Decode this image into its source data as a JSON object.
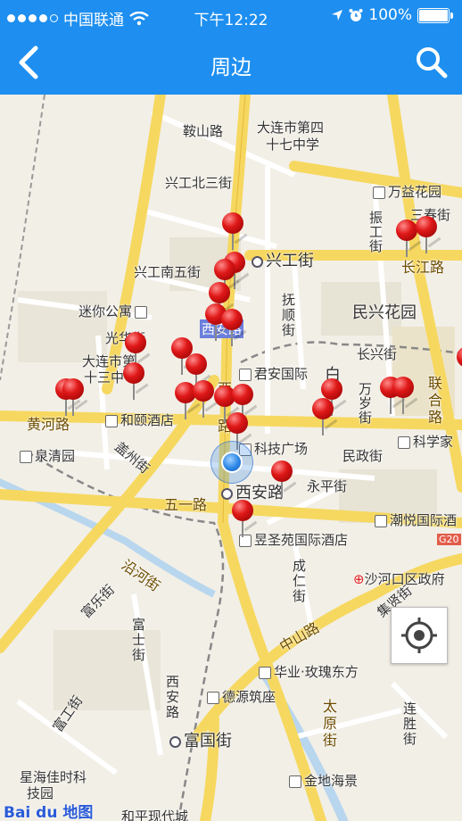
{
  "status_bar": {
    "carrier": "中国联通",
    "time": "下午12:22",
    "battery": "100%"
  },
  "nav": {
    "title": "周边"
  },
  "map": {
    "labels": {
      "anshan_lu": "鞍山路",
      "school_1": "大连市第四",
      "school_2": "十七中学",
      "xinggong_bei3": "兴工北三街",
      "wanyi_garden": "万益花园",
      "zhengong_jie": "振工街",
      "sanchun_jie": "三春街",
      "xinggong_jie": "兴工街",
      "changjiang_lu": "长江路",
      "xinggong_nan5": "兴工南五街",
      "fushun_jie": "抚顺街",
      "minxing_garden": "民兴花园",
      "mini_apartment": "迷你公寓",
      "xi_anlu_highlight": "西安路",
      "guanghua_jie": "光华街",
      "changxing_jie": "长兴街",
      "school13_1": "大连市第",
      "school13_2": "十三中",
      "junan_intl": "君安国际",
      "bai": "白",
      "wansui_jie": "万岁街",
      "lianhe_lu": "联合路",
      "xi_vertical": "西",
      "huanghe_lu": "黄河路",
      "heyi_hotel": "和颐酒店",
      "lu_vertical": "路",
      "keji_guangchang": "科技广场",
      "kexuejia": "科学家",
      "gaizhou_jie": "盖州街",
      "quanqing_yuan": "泉清园",
      "minzheng_jie": "民政街",
      "xian_lu": "西安路",
      "yongping_jie": "永平街",
      "wuyi_lu": "五一路",
      "chaoyue_intl": "潮悦国际酒",
      "g20": "G20",
      "yishengyuan_hotel": "昱圣苑国际酒店",
      "chengren_jie": "成仁街",
      "shahekou_gov": "沙河口区政府",
      "yanhe_jie": "沿河街",
      "zhongshan_lu": "中山路",
      "jixian_jie": "集贤街",
      "fule_jie": "富乐街",
      "fushi_jie": "富士街",
      "huaye_meigui": "华业·玫瑰东方",
      "deyuan_zhuzuo": "德源筑座",
      "xian_lu_vertical": "西安路",
      "fugong_jie": "富工街",
      "taiyuan_jie": "太原街",
      "liansheng_jie": "连胜街",
      "fuguo_jie": "富国街",
      "xinghai_jiake": "星海佳时科",
      "jiyuan": "技园",
      "jindi_haijing": "金地海景",
      "heping_dai": "和平现代城"
    },
    "logo": "Bai du 地图",
    "pin_count": 30
  },
  "icons": {
    "back": "chevron-left-icon",
    "search": "search-icon",
    "locate": "locate-me-icon",
    "wifi": "wifi-icon",
    "location_arrow": "location-arrow-icon",
    "alarm": "alarm-icon",
    "battery": "battery-icon"
  },
  "colors": {
    "header_blue": "#1e8ff0",
    "pin_red": "#e01818",
    "road_yellow": "#f6d860",
    "water_blue": "#b8d6ee"
  }
}
